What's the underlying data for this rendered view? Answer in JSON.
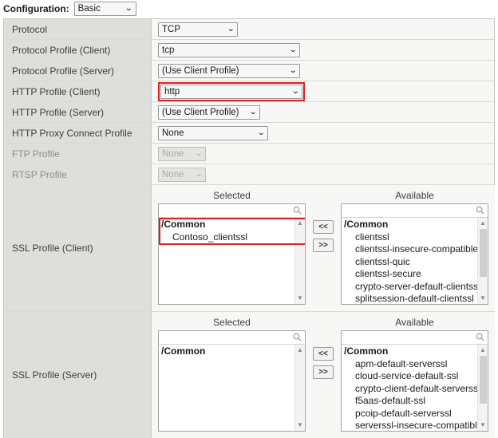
{
  "config_bar": {
    "label": "Configuration:",
    "value": "Basic",
    "caret": "⌄"
  },
  "rows": [
    {
      "label": "Protocol",
      "value": "TCP",
      "disabled": false,
      "highlight": false
    },
    {
      "label": "Protocol Profile (Client)",
      "value": "tcp",
      "disabled": false,
      "highlight": false
    },
    {
      "label": "Protocol Profile (Server)",
      "value": "(Use Client Profile)",
      "disabled": false,
      "highlight": false
    },
    {
      "label": "HTTP Profile (Client)",
      "value": "http",
      "disabled": false,
      "highlight": true
    },
    {
      "label": "HTTP Profile (Server)",
      "value": "(Use Client Profile)",
      "disabled": false,
      "highlight": false
    },
    {
      "label": "HTTP Proxy Connect Profile",
      "value": "None",
      "disabled": false,
      "highlight": false
    },
    {
      "label": "FTP Profile",
      "value": "None",
      "disabled": true,
      "highlight": false
    },
    {
      "label": "RTSP Profile",
      "value": "None",
      "disabled": true,
      "highlight": false
    }
  ],
  "ssl_client": {
    "label": "SSL Profile (Client)",
    "selected_header": "Selected",
    "available_header": "Available",
    "search_placeholder": "",
    "selected_items": [
      {
        "text": "/Common",
        "type": "folder"
      },
      {
        "text": "Contoso_clientssl",
        "type": "child"
      }
    ],
    "available_items": [
      {
        "text": "/Common",
        "type": "folder"
      },
      {
        "text": "clientssl",
        "type": "child"
      },
      {
        "text": "clientssl-insecure-compatible",
        "type": "child"
      },
      {
        "text": "clientssl-quic",
        "type": "child"
      },
      {
        "text": "clientssl-secure",
        "type": "child"
      },
      {
        "text": "crypto-server-default-clientssl",
        "type": "child"
      },
      {
        "text": "splitsession-default-clientssl",
        "type": "child"
      }
    ],
    "move_left_label": "<<",
    "move_right_label": ">>"
  },
  "ssl_server": {
    "label": "SSL Profile (Server)",
    "selected_header": "Selected",
    "available_header": "Available",
    "search_placeholder": "",
    "selected_items": [
      {
        "text": "/Common",
        "type": "folder"
      }
    ],
    "available_items": [
      {
        "text": "/Common",
        "type": "folder"
      },
      {
        "text": "apm-default-serverssl",
        "type": "child"
      },
      {
        "text": "cloud-service-default-ssl",
        "type": "child"
      },
      {
        "text": "crypto-client-default-serverssl",
        "type": "child"
      },
      {
        "text": "f5aas-default-ssl",
        "type": "child"
      },
      {
        "text": "pcoip-default-serverssl",
        "type": "child"
      },
      {
        "text": "serverssl-insecure-compatible",
        "type": "child"
      }
    ],
    "move_left_label": "<<",
    "move_right_label": ">>"
  },
  "icons": {
    "search": "search-icon",
    "caret_down": "chevron-down-icon",
    "scroll_up": "▲",
    "scroll_down": "▼"
  },
  "colors": {
    "highlight": "#e02020",
    "label_bg": "#dedeDB",
    "value_bg": "#f7f7f5"
  }
}
